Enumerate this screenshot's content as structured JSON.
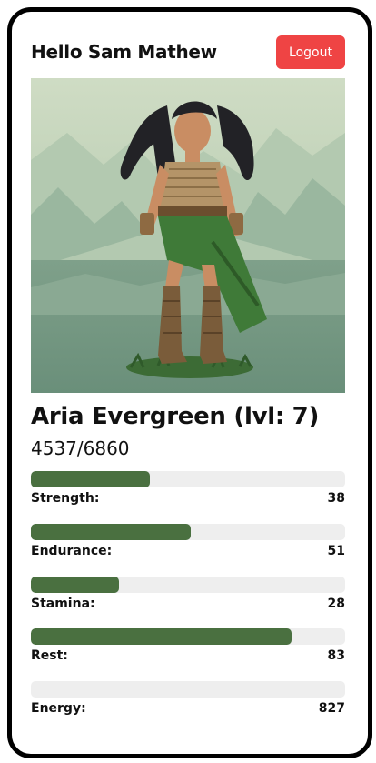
{
  "header": {
    "greeting": "Hello Sam Mathew",
    "logout_label": "Logout"
  },
  "character": {
    "portrait_icon": "warrior-character-portrait",
    "name_line": "Aria Evergreen (lvl: 7)",
    "xp_line": "4537/6860"
  },
  "stats": [
    {
      "label": "Strength:",
      "value": "38",
      "bar_fraction": 0.38
    },
    {
      "label": "Endurance:",
      "value": "51",
      "bar_fraction": 0.51
    },
    {
      "label": "Stamina:",
      "value": "28",
      "bar_fraction": 0.28
    },
    {
      "label": "Rest:",
      "value": "83",
      "bar_fraction": 0.83
    },
    {
      "label": "Energy:",
      "value": "827",
      "bar_fraction": 0
    }
  ],
  "colors": {
    "logout_button": "#ef4444",
    "bar_fill": "#4a7040",
    "bar_track": "#eeeeee",
    "frame": "#000000"
  }
}
